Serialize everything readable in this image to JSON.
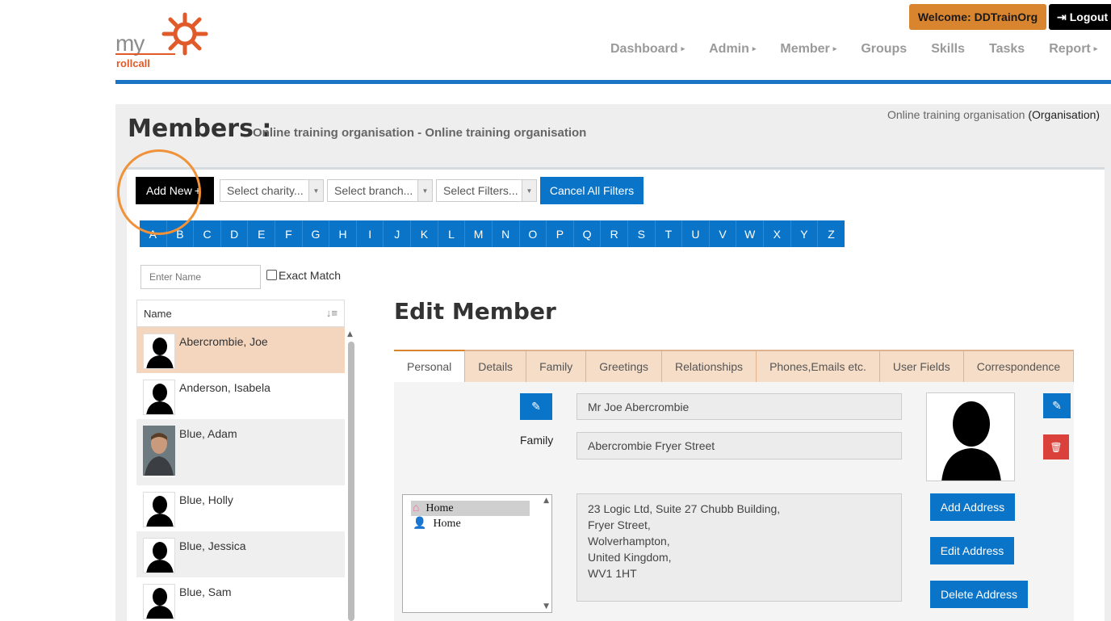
{
  "header": {
    "logo_my": "my",
    "logo_rollcall": "rollcall",
    "welcome": "Welcome: DDTrainOrg",
    "logout": "Logout",
    "nav": [
      {
        "label": "Dashboard",
        "has_caret": true
      },
      {
        "label": "Admin",
        "has_caret": true
      },
      {
        "label": "Member",
        "has_caret": true
      },
      {
        "label": "Groups",
        "has_caret": false
      },
      {
        "label": "Skills",
        "has_caret": false
      },
      {
        "label": "Tasks",
        "has_caret": false
      },
      {
        "label": "Report",
        "has_caret": true
      }
    ]
  },
  "page": {
    "title": "Members :",
    "subtitle": "Online training organisation - Online training organisation",
    "org_name": "Online training organisation",
    "org_type": "(Organisation)"
  },
  "filters": {
    "add_new": "Add New",
    "charity": "Select charity...",
    "branch": "Select branch...",
    "filters": "Select Filters...",
    "cancel_all": "Cancel All Filters"
  },
  "alphabet": [
    "A",
    "B",
    "C",
    "D",
    "E",
    "F",
    "G",
    "H",
    "I",
    "J",
    "K",
    "L",
    "M",
    "N",
    "O",
    "P",
    "Q",
    "R",
    "S",
    "T",
    "U",
    "V",
    "W",
    "X",
    "Y",
    "Z"
  ],
  "search": {
    "placeholder": "Enter Name",
    "exact_match": "Exact Match"
  },
  "member_list": {
    "header": "Name",
    "members": [
      {
        "name": "Abercrombie, Joe",
        "selected": true,
        "photo": "silhouette"
      },
      {
        "name": "Anderson, Isabela",
        "selected": false,
        "photo": "silhouette"
      },
      {
        "name": "Blue, Adam",
        "selected": false,
        "photo": "portrait"
      },
      {
        "name": "Blue, Holly",
        "selected": false,
        "photo": "silhouette"
      },
      {
        "name": "Blue, Jessica",
        "selected": false,
        "photo": "silhouette"
      },
      {
        "name": "Blue, Sam",
        "selected": false,
        "photo": "silhouette"
      }
    ]
  },
  "edit_member": {
    "title": "Edit Member",
    "tabs": [
      "Personal",
      "Details",
      "Family",
      "Greetings",
      "Relationships",
      "Phones,Emails etc.",
      "User Fields",
      "Correspondence"
    ],
    "active_tab": "Personal",
    "family_label": "Family",
    "full_name": "Mr Joe Abercrombie",
    "family_name": "Abercrombie Fryer Street",
    "addresses": [
      {
        "label": "Home",
        "icon": "house-icon",
        "selected": true
      },
      {
        "label": "Home",
        "icon": "person-icon",
        "selected": false
      }
    ],
    "address_lines": [
      "23 Logic Ltd, Suite 27 Chubb Building,",
      "Fryer Street,",
      "Wolverhampton,",
      "United Kingdom,",
      "WV1 1HT"
    ],
    "add_address": "Add Address",
    "edit_address": "Edit Address",
    "delete_address": "Delete Address"
  },
  "colors": {
    "primary_blue": "#0a74c9",
    "orange": "#d9842e",
    "selected_row": "#f4d6bf",
    "highlight_circle": "#f0923a",
    "delete_red": "#d9413a"
  }
}
